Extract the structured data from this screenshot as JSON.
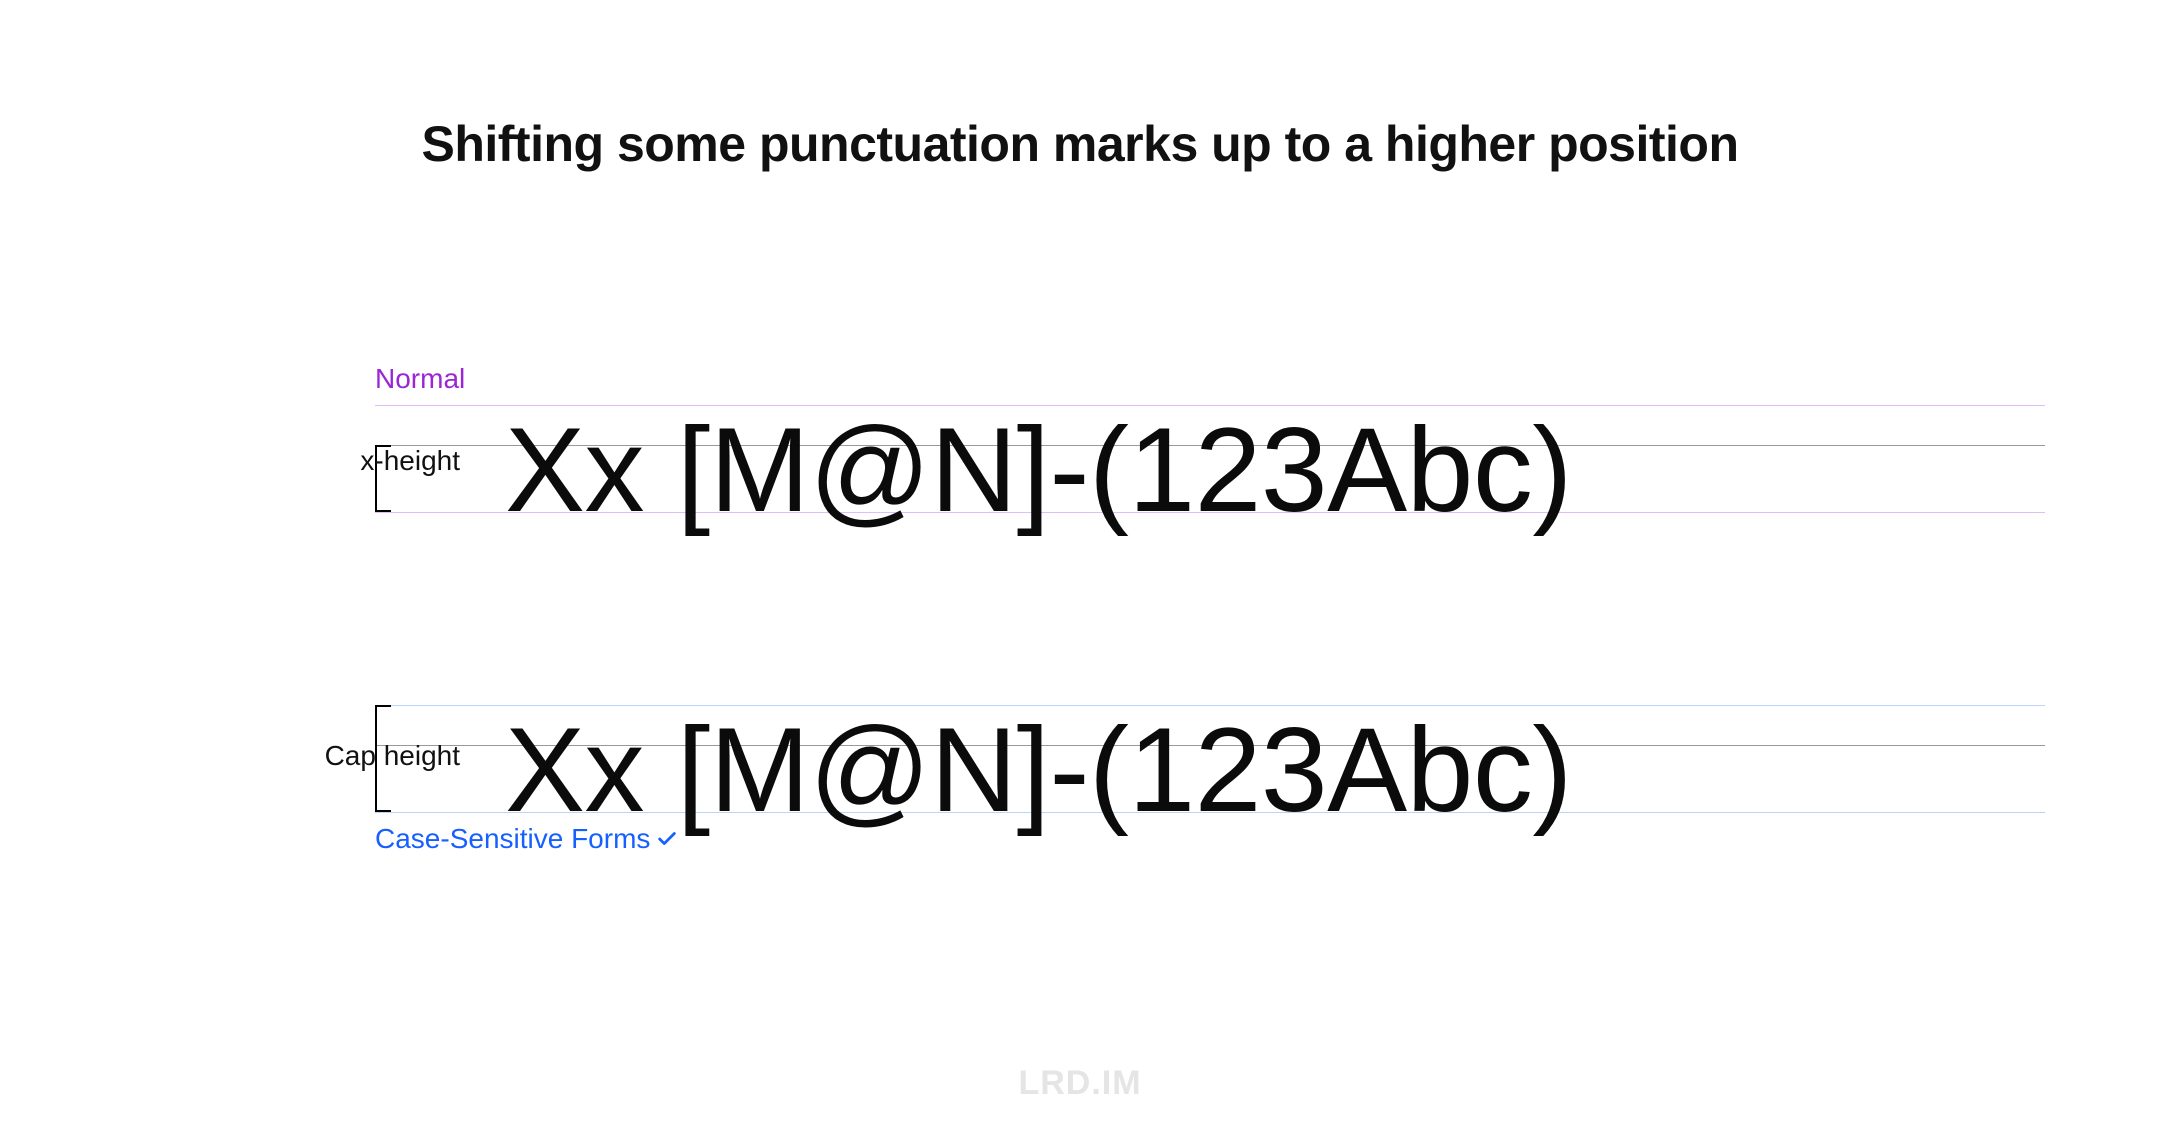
{
  "title": "Shifting some punctuation marks up to a higher position",
  "sample_text": "Xx [M@N]-(123Abc)",
  "labels": {
    "x_height": "x-height",
    "cap_height": "Cap height",
    "normal": "Normal",
    "case_sensitive": "Case-Sensitive Forms"
  },
  "watermark": "LRD.IM",
  "colors": {
    "purple": "#9b26d6",
    "blue": "#1760ff",
    "guide_purple": "#e1bdf5",
    "guide_blue": "#bcd3fb",
    "guide_gray": "#999999"
  }
}
